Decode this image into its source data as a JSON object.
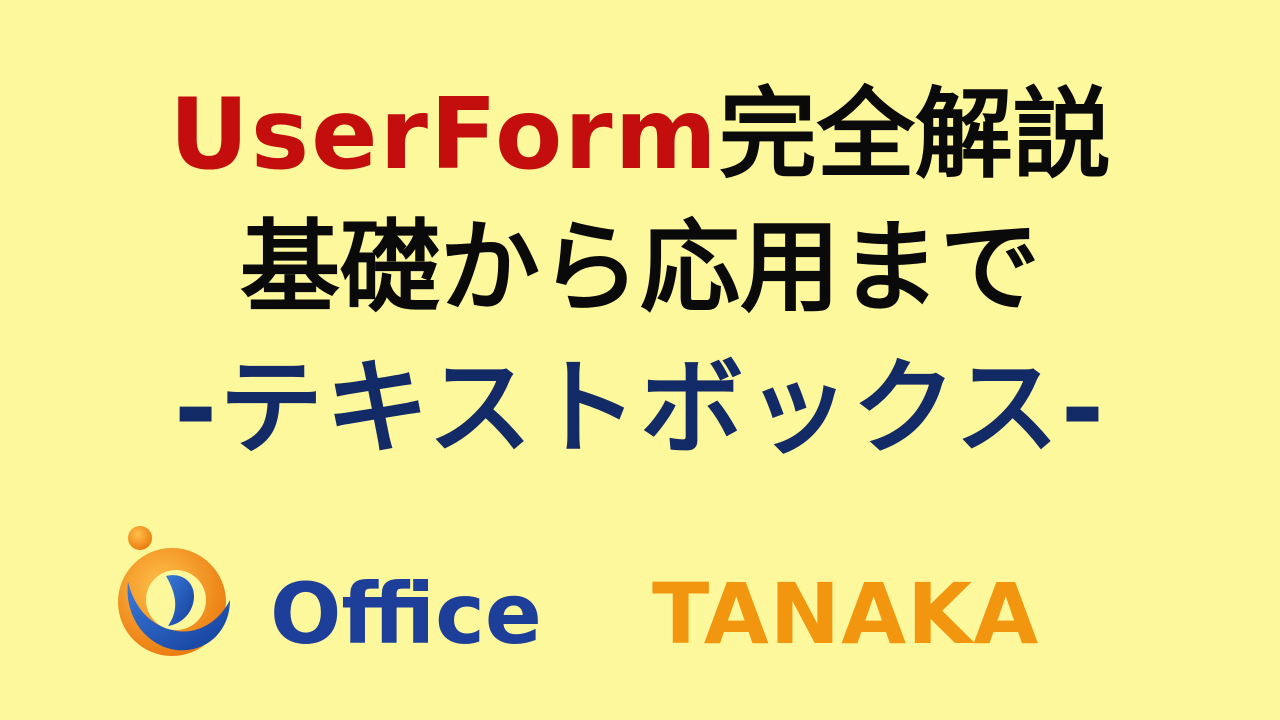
{
  "title": {
    "line1_accent": "UserForm",
    "line1_rest": "完全解説",
    "line2": "基礎から応用まで",
    "line3": "-テキストボックス-"
  },
  "brand": {
    "office": "Office",
    "tanaka": "TANAKA",
    "logo_icon": "office-tanaka-logo-icon"
  },
  "colors": {
    "background": "#fdf89c",
    "accent_red": "#c40d0d",
    "navy": "#122a66",
    "brand_blue": "#1d3f9a",
    "brand_orange": "#f2960f"
  }
}
